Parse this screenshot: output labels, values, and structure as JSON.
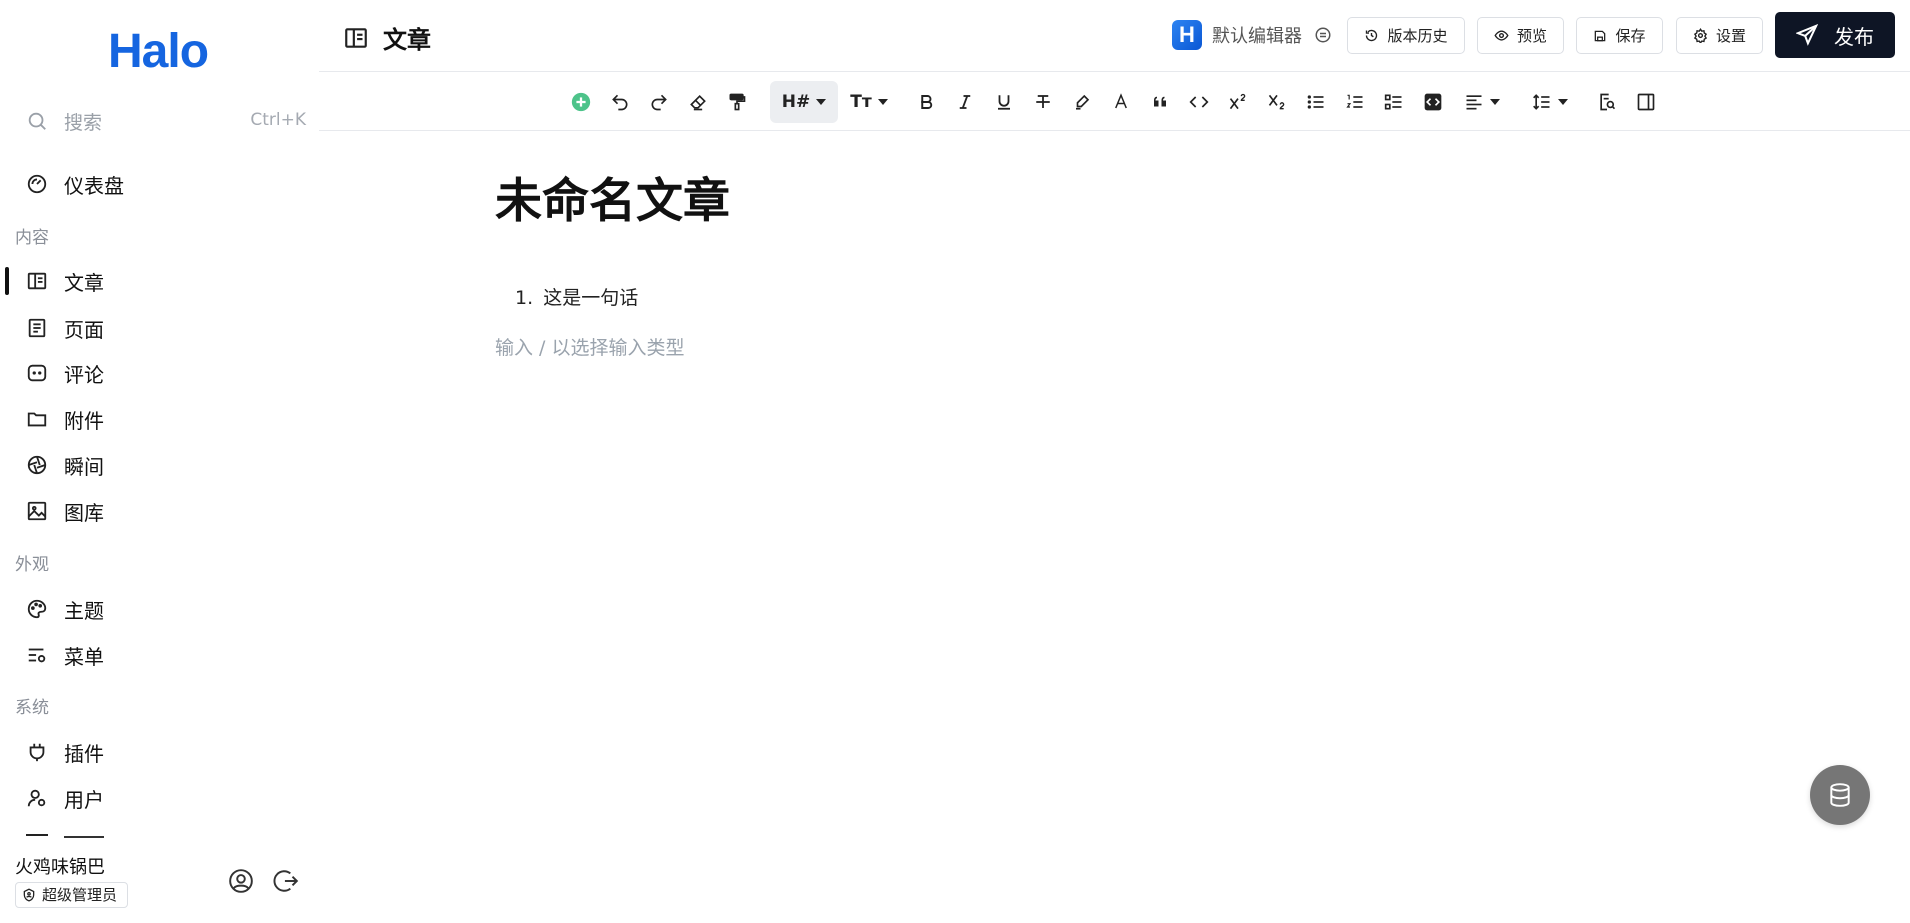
{
  "sidebar": {
    "logo": "Halo",
    "search": {
      "placeholder": "搜索",
      "shortcut": "Ctrl+K"
    },
    "dashboard": "仪表盘",
    "sections": {
      "content": "内容",
      "appearance": "外观",
      "system": "系统"
    },
    "content_items": [
      "文章",
      "页面",
      "评论",
      "附件",
      "瞬间",
      "图库"
    ],
    "appearance_items": [
      "主题",
      "菜单"
    ],
    "system_items": [
      "插件",
      "用户"
    ],
    "user": {
      "name": "火鸡味锅巴",
      "role": "超级管理员"
    }
  },
  "header": {
    "title": "文章",
    "editor": {
      "badge": "H",
      "label": "默认编辑器"
    },
    "buttons": {
      "history": "版本历史",
      "preview": "预览",
      "save": "保存",
      "settings": "设置",
      "publish": "发布"
    }
  },
  "toolbar": {
    "heading_label": "H#",
    "font_size_label": "Tт",
    "colors": {
      "add": "#4dc38a"
    }
  },
  "document": {
    "title": "未命名文章",
    "list_number": "1.",
    "list_text": "这是一句话",
    "placeholder": "输入 / 以选择输入类型"
  },
  "colors": {
    "brand": "#1565e0",
    "publish_bg": "#0e1525",
    "fab_bg": "#767676"
  }
}
